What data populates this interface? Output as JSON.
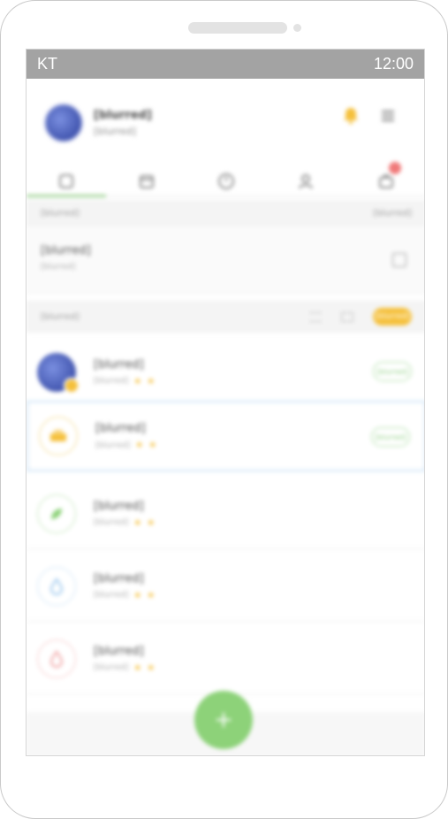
{
  "status_bar": {
    "carrier": "KT",
    "time": "12:00"
  },
  "profile": {
    "name": "[blurred]",
    "subtitle": "[blurred]"
  },
  "tabs": [
    {
      "icon": "home-icon"
    },
    {
      "icon": "calendar-icon"
    },
    {
      "icon": "clock-icon"
    },
    {
      "icon": "person-icon"
    },
    {
      "icon": "cart-icon"
    }
  ],
  "notice_section": {
    "title": "[blurred]",
    "more": "[blurred]"
  },
  "notice": {
    "title": "[blurred]",
    "meta": "[blurred]"
  },
  "feed_section": {
    "title": "[blurred]",
    "pill": "[blurred]"
  },
  "feed_items": [
    {
      "title": "[blurred]",
      "meta": "[blurred]",
      "pill": "[blurred]"
    },
    {
      "title": "[blurred]",
      "meta": "[blurred]",
      "pill": "[blurred]"
    },
    {
      "title": "[blurred]",
      "meta": "[blurred]"
    },
    {
      "title": "[blurred]",
      "meta": "[blurred]"
    },
    {
      "title": "[blurred]",
      "meta": "[blurred]"
    }
  ],
  "fab": {
    "label": "+"
  },
  "colors": {
    "accent_green": "#8dd279",
    "accent_yellow": "#f5c03b",
    "status_bar": "#a3a3a3",
    "badge_red": "#f07a7a"
  }
}
